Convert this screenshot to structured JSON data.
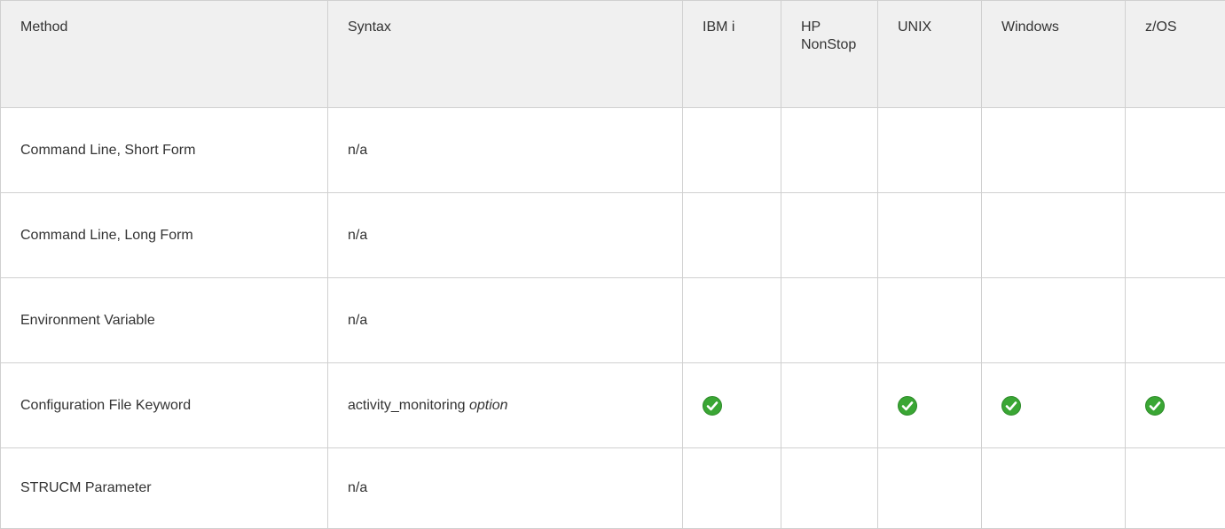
{
  "table": {
    "columns": [
      {
        "key": "method",
        "label": "Method"
      },
      {
        "key": "syntax",
        "label": "Syntax"
      },
      {
        "key": "ibmi",
        "label": "IBM i"
      },
      {
        "key": "hpnonstop",
        "label": "HP NonStop"
      },
      {
        "key": "unix",
        "label": "UNIX"
      },
      {
        "key": "windows",
        "label": "Windows"
      },
      {
        "key": "zos",
        "label": "z/OS"
      }
    ],
    "hp_label_line1": "HP",
    "hp_label_line2": "NonStop",
    "rows": [
      {
        "method": "Command Line, Short Form",
        "syntax": "n/a",
        "syntax_arg": "",
        "ibmi": false,
        "hpnonstop": false,
        "unix": false,
        "windows": false,
        "zos": false
      },
      {
        "method": "Command Line, Long Form",
        "syntax": "n/a",
        "syntax_arg": "",
        "ibmi": false,
        "hpnonstop": false,
        "unix": false,
        "windows": false,
        "zos": false
      },
      {
        "method": "Environment Variable",
        "syntax": "n/a",
        "syntax_arg": "",
        "ibmi": false,
        "hpnonstop": false,
        "unix": false,
        "windows": false,
        "zos": false
      },
      {
        "method": "Configuration File Keyword",
        "syntax": "activity_monitoring",
        "syntax_arg": "option",
        "ibmi": true,
        "hpnonstop": false,
        "unix": true,
        "windows": true,
        "zos": true
      },
      {
        "method": "STRUCM Parameter",
        "syntax": "n/a",
        "syntax_arg": "",
        "ibmi": false,
        "hpnonstop": false,
        "unix": false,
        "windows": false,
        "zos": false
      }
    ]
  },
  "icons": {
    "supported": "check-circle-icon"
  },
  "colors": {
    "header_bg": "#f0f0f0",
    "border": "#d0d0d0",
    "text": "#333333",
    "check_green": "#3aa634"
  }
}
